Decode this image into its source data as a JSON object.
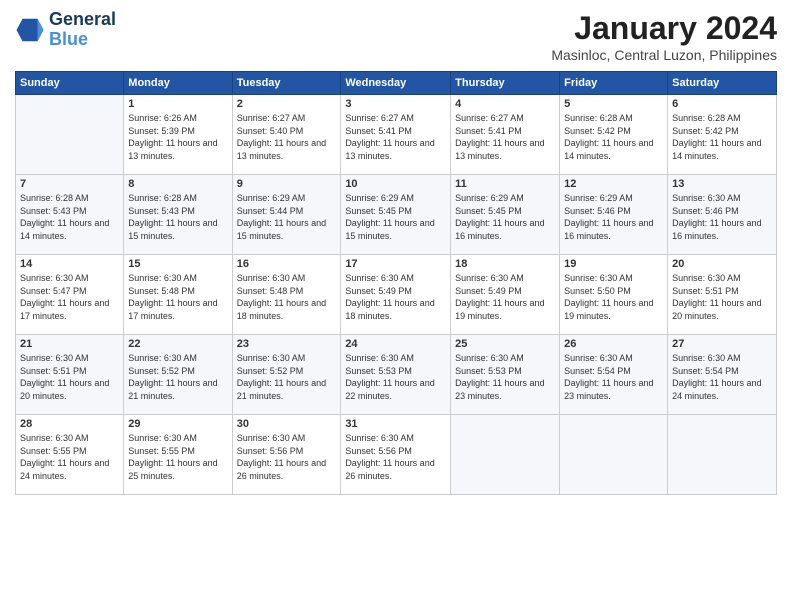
{
  "header": {
    "logo_line1": "General",
    "logo_line2": "Blue",
    "month_title": "January 2024",
    "location": "Masinloc, Central Luzon, Philippines"
  },
  "weekdays": [
    "Sunday",
    "Monday",
    "Tuesday",
    "Wednesday",
    "Thursday",
    "Friday",
    "Saturday"
  ],
  "weeks": [
    [
      {
        "day": "",
        "sunrise": "",
        "sunset": "",
        "daylight": ""
      },
      {
        "day": "1",
        "sunrise": "Sunrise: 6:26 AM",
        "sunset": "Sunset: 5:39 PM",
        "daylight": "Daylight: 11 hours and 13 minutes."
      },
      {
        "day": "2",
        "sunrise": "Sunrise: 6:27 AM",
        "sunset": "Sunset: 5:40 PM",
        "daylight": "Daylight: 11 hours and 13 minutes."
      },
      {
        "day": "3",
        "sunrise": "Sunrise: 6:27 AM",
        "sunset": "Sunset: 5:41 PM",
        "daylight": "Daylight: 11 hours and 13 minutes."
      },
      {
        "day": "4",
        "sunrise": "Sunrise: 6:27 AM",
        "sunset": "Sunset: 5:41 PM",
        "daylight": "Daylight: 11 hours and 13 minutes."
      },
      {
        "day": "5",
        "sunrise": "Sunrise: 6:28 AM",
        "sunset": "Sunset: 5:42 PM",
        "daylight": "Daylight: 11 hours and 14 minutes."
      },
      {
        "day": "6",
        "sunrise": "Sunrise: 6:28 AM",
        "sunset": "Sunset: 5:42 PM",
        "daylight": "Daylight: 11 hours and 14 minutes."
      }
    ],
    [
      {
        "day": "7",
        "sunrise": "Sunrise: 6:28 AM",
        "sunset": "Sunset: 5:43 PM",
        "daylight": "Daylight: 11 hours and 14 minutes."
      },
      {
        "day": "8",
        "sunrise": "Sunrise: 6:28 AM",
        "sunset": "Sunset: 5:43 PM",
        "daylight": "Daylight: 11 hours and 15 minutes."
      },
      {
        "day": "9",
        "sunrise": "Sunrise: 6:29 AM",
        "sunset": "Sunset: 5:44 PM",
        "daylight": "Daylight: 11 hours and 15 minutes."
      },
      {
        "day": "10",
        "sunrise": "Sunrise: 6:29 AM",
        "sunset": "Sunset: 5:45 PM",
        "daylight": "Daylight: 11 hours and 15 minutes."
      },
      {
        "day": "11",
        "sunrise": "Sunrise: 6:29 AM",
        "sunset": "Sunset: 5:45 PM",
        "daylight": "Daylight: 11 hours and 16 minutes."
      },
      {
        "day": "12",
        "sunrise": "Sunrise: 6:29 AM",
        "sunset": "Sunset: 5:46 PM",
        "daylight": "Daylight: 11 hours and 16 minutes."
      },
      {
        "day": "13",
        "sunrise": "Sunrise: 6:30 AM",
        "sunset": "Sunset: 5:46 PM",
        "daylight": "Daylight: 11 hours and 16 minutes."
      }
    ],
    [
      {
        "day": "14",
        "sunrise": "Sunrise: 6:30 AM",
        "sunset": "Sunset: 5:47 PM",
        "daylight": "Daylight: 11 hours and 17 minutes."
      },
      {
        "day": "15",
        "sunrise": "Sunrise: 6:30 AM",
        "sunset": "Sunset: 5:48 PM",
        "daylight": "Daylight: 11 hours and 17 minutes."
      },
      {
        "day": "16",
        "sunrise": "Sunrise: 6:30 AM",
        "sunset": "Sunset: 5:48 PM",
        "daylight": "Daylight: 11 hours and 18 minutes."
      },
      {
        "day": "17",
        "sunrise": "Sunrise: 6:30 AM",
        "sunset": "Sunset: 5:49 PM",
        "daylight": "Daylight: 11 hours and 18 minutes."
      },
      {
        "day": "18",
        "sunrise": "Sunrise: 6:30 AM",
        "sunset": "Sunset: 5:49 PM",
        "daylight": "Daylight: 11 hours and 19 minutes."
      },
      {
        "day": "19",
        "sunrise": "Sunrise: 6:30 AM",
        "sunset": "Sunset: 5:50 PM",
        "daylight": "Daylight: 11 hours and 19 minutes."
      },
      {
        "day": "20",
        "sunrise": "Sunrise: 6:30 AM",
        "sunset": "Sunset: 5:51 PM",
        "daylight": "Daylight: 11 hours and 20 minutes."
      }
    ],
    [
      {
        "day": "21",
        "sunrise": "Sunrise: 6:30 AM",
        "sunset": "Sunset: 5:51 PM",
        "daylight": "Daylight: 11 hours and 20 minutes."
      },
      {
        "day": "22",
        "sunrise": "Sunrise: 6:30 AM",
        "sunset": "Sunset: 5:52 PM",
        "daylight": "Daylight: 11 hours and 21 minutes."
      },
      {
        "day": "23",
        "sunrise": "Sunrise: 6:30 AM",
        "sunset": "Sunset: 5:52 PM",
        "daylight": "Daylight: 11 hours and 21 minutes."
      },
      {
        "day": "24",
        "sunrise": "Sunrise: 6:30 AM",
        "sunset": "Sunset: 5:53 PM",
        "daylight": "Daylight: 11 hours and 22 minutes."
      },
      {
        "day": "25",
        "sunrise": "Sunrise: 6:30 AM",
        "sunset": "Sunset: 5:53 PM",
        "daylight": "Daylight: 11 hours and 23 minutes."
      },
      {
        "day": "26",
        "sunrise": "Sunrise: 6:30 AM",
        "sunset": "Sunset: 5:54 PM",
        "daylight": "Daylight: 11 hours and 23 minutes."
      },
      {
        "day": "27",
        "sunrise": "Sunrise: 6:30 AM",
        "sunset": "Sunset: 5:54 PM",
        "daylight": "Daylight: 11 hours and 24 minutes."
      }
    ],
    [
      {
        "day": "28",
        "sunrise": "Sunrise: 6:30 AM",
        "sunset": "Sunset: 5:55 PM",
        "daylight": "Daylight: 11 hours and 24 minutes."
      },
      {
        "day": "29",
        "sunrise": "Sunrise: 6:30 AM",
        "sunset": "Sunset: 5:55 PM",
        "daylight": "Daylight: 11 hours and 25 minutes."
      },
      {
        "day": "30",
        "sunrise": "Sunrise: 6:30 AM",
        "sunset": "Sunset: 5:56 PM",
        "daylight": "Daylight: 11 hours and 26 minutes."
      },
      {
        "day": "31",
        "sunrise": "Sunrise: 6:30 AM",
        "sunset": "Sunset: 5:56 PM",
        "daylight": "Daylight: 11 hours and 26 minutes."
      },
      {
        "day": "",
        "sunrise": "",
        "sunset": "",
        "daylight": ""
      },
      {
        "day": "",
        "sunrise": "",
        "sunset": "",
        "daylight": ""
      },
      {
        "day": "",
        "sunrise": "",
        "sunset": "",
        "daylight": ""
      }
    ]
  ]
}
